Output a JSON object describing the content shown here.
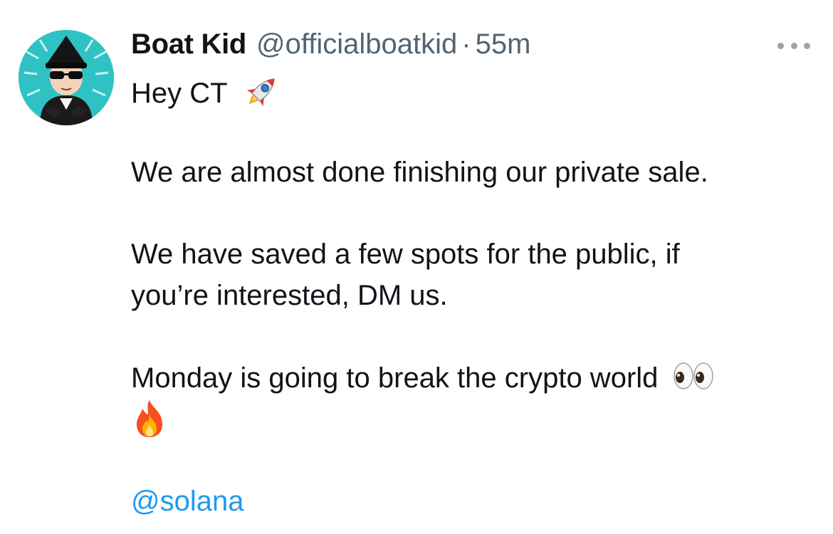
{
  "tweet": {
    "author": {
      "display_name": "Boat Kid",
      "handle": "@officialboatkid",
      "avatar_bg": "#2fc2c4"
    },
    "separator": "·",
    "time": "55m",
    "more_icon": "more-horizontal-icon",
    "lines": {
      "l1": "Hey CT",
      "l2": "We are almost done finishing our private sale.",
      "l3": "We have saved a few spots for the public, if",
      "l4": "you’re interested, DM us.",
      "l5": "Monday is going to break the crypto world"
    },
    "emojis": {
      "rocket": "rocket-icon",
      "eyes": "eyes-icon",
      "fire": "fire-icon"
    },
    "mention": "@solana",
    "colors": {
      "text": "#0f1419",
      "secondary": "#536471",
      "link": "#1d9bf0"
    }
  }
}
